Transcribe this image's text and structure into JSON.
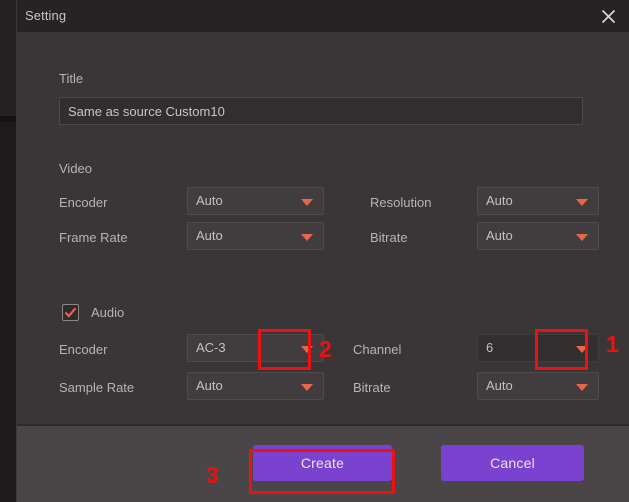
{
  "window": {
    "title": "Setting",
    "close_icon": "close-icon"
  },
  "form": {
    "title_group": {
      "label": "Title",
      "value": "Same as source Custom10",
      "placeholder": "Title"
    },
    "video": {
      "section_label": "Video",
      "fields": [
        {
          "label": "Encoder",
          "value": "Auto"
        },
        {
          "label": "Resolution",
          "value": "Auto"
        },
        {
          "label": "Frame Rate",
          "value": "Auto"
        },
        {
          "label": "Bitrate",
          "value": "Auto"
        }
      ]
    },
    "audio": {
      "section_label": "Audio",
      "enabled": true,
      "check_icon": "check-icon",
      "fields": [
        {
          "label": "Encoder",
          "value": "AC-3"
        },
        {
          "label": "Channel",
          "value": "6"
        },
        {
          "label": "Sample Rate",
          "value": "Auto"
        },
        {
          "label": "Bitrate",
          "value": "Auto"
        }
      ]
    }
  },
  "footer": {
    "create_label": "Create",
    "cancel_label": "Cancel"
  },
  "annotations": {
    "step1": "1",
    "step2": "2",
    "step3": "3"
  },
  "colors": {
    "accent_arrow": "#e8674a",
    "button_purple": "#7b42cf",
    "annotation_red": "#ee1111",
    "dialog_bg": "#3a3637",
    "titlebar_bg": "#262324",
    "footer_bg": "#4a4546"
  }
}
